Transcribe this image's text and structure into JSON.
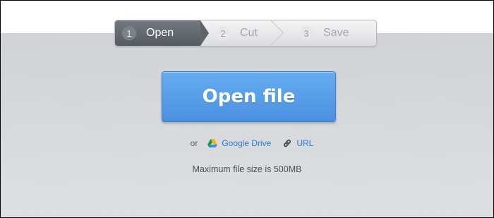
{
  "steps": [
    {
      "number": "1",
      "label": "Open"
    },
    {
      "number": "2",
      "label": "Cut"
    },
    {
      "number": "3",
      "label": "Save"
    }
  ],
  "open_button": {
    "label": "Open file"
  },
  "alternatives": {
    "or_text": "or",
    "google_drive": "Google Drive",
    "url": "URL"
  },
  "max_size_text": "Maximum file size is 500MB",
  "colors": {
    "active_step": "#5f646b",
    "button_blue": "#5aa0ea",
    "link_blue": "#2a7ad4",
    "background": "#d3d5d9"
  },
  "active_step_index": 1
}
